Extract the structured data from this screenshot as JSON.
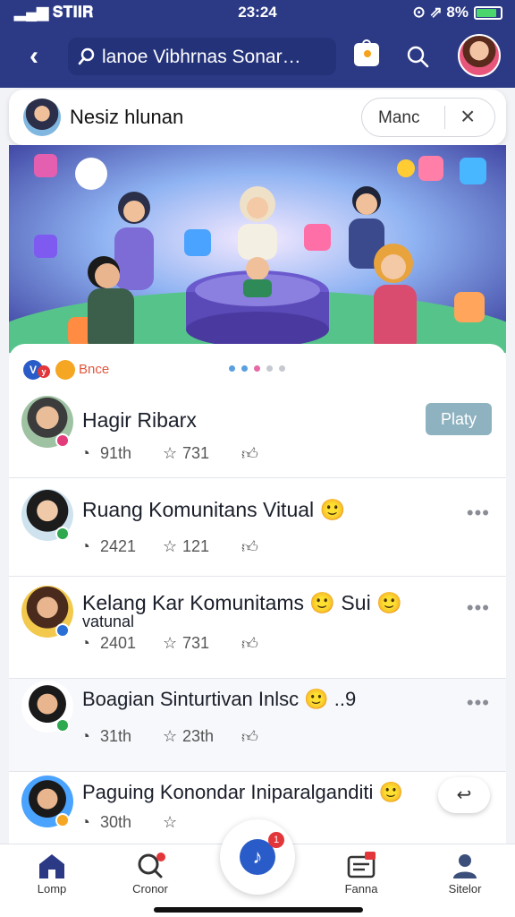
{
  "status_bar": {
    "carrier": "𝐒𝐓𝐈𝐈𝐑 ",
    "time": "23:24",
    "right": "⊙ ⇗ 8%",
    "battery_color": "#4ad66d"
  },
  "nav": {
    "search_text": "lanoe Vibhrnas Sonar…"
  },
  "community": {
    "name": "Nesiz hlunan",
    "action_label": "Manc",
    "close_glyph": "×"
  },
  "feed": {
    "tag_label": "Bnce",
    "tag_letters": [
      "V",
      "y"
    ],
    "pager_dots": 5,
    "posts": [
      {
        "title": "Hagir Ribarx",
        "comments": "91th",
        "likes": "731",
        "action": "Platy",
        "badge_color": "#e23c7a"
      },
      {
        "title": "Ruang Komunitans Vitual 🙂",
        "comments": "2421",
        "likes": "121",
        "badge_color": "#2fa84f"
      },
      {
        "title": "Kelang Kar Komunitams 🙂 Sui 🙂",
        "subtitle": "vatunal",
        "comments": "2401",
        "likes": "731",
        "badge_color": "#2a6fd6"
      },
      {
        "title": "Boagian Sinturtivan Inlsc 🙂 ..9",
        "comments": "31th",
        "likes": "23th",
        "badge_color": "#2fa84f"
      },
      {
        "title": "Paguing Konondar Iniparalganditi 🙂",
        "comments": "30th",
        "likes": "",
        "badge_color": "#f5a623"
      }
    ]
  },
  "tabs": [
    {
      "label": "Lomp"
    },
    {
      "label": "Cronor"
    },
    {
      "label": ""
    },
    {
      "label": "Fanna"
    },
    {
      "label": "Sitelor"
    }
  ],
  "fab_badge": "1"
}
